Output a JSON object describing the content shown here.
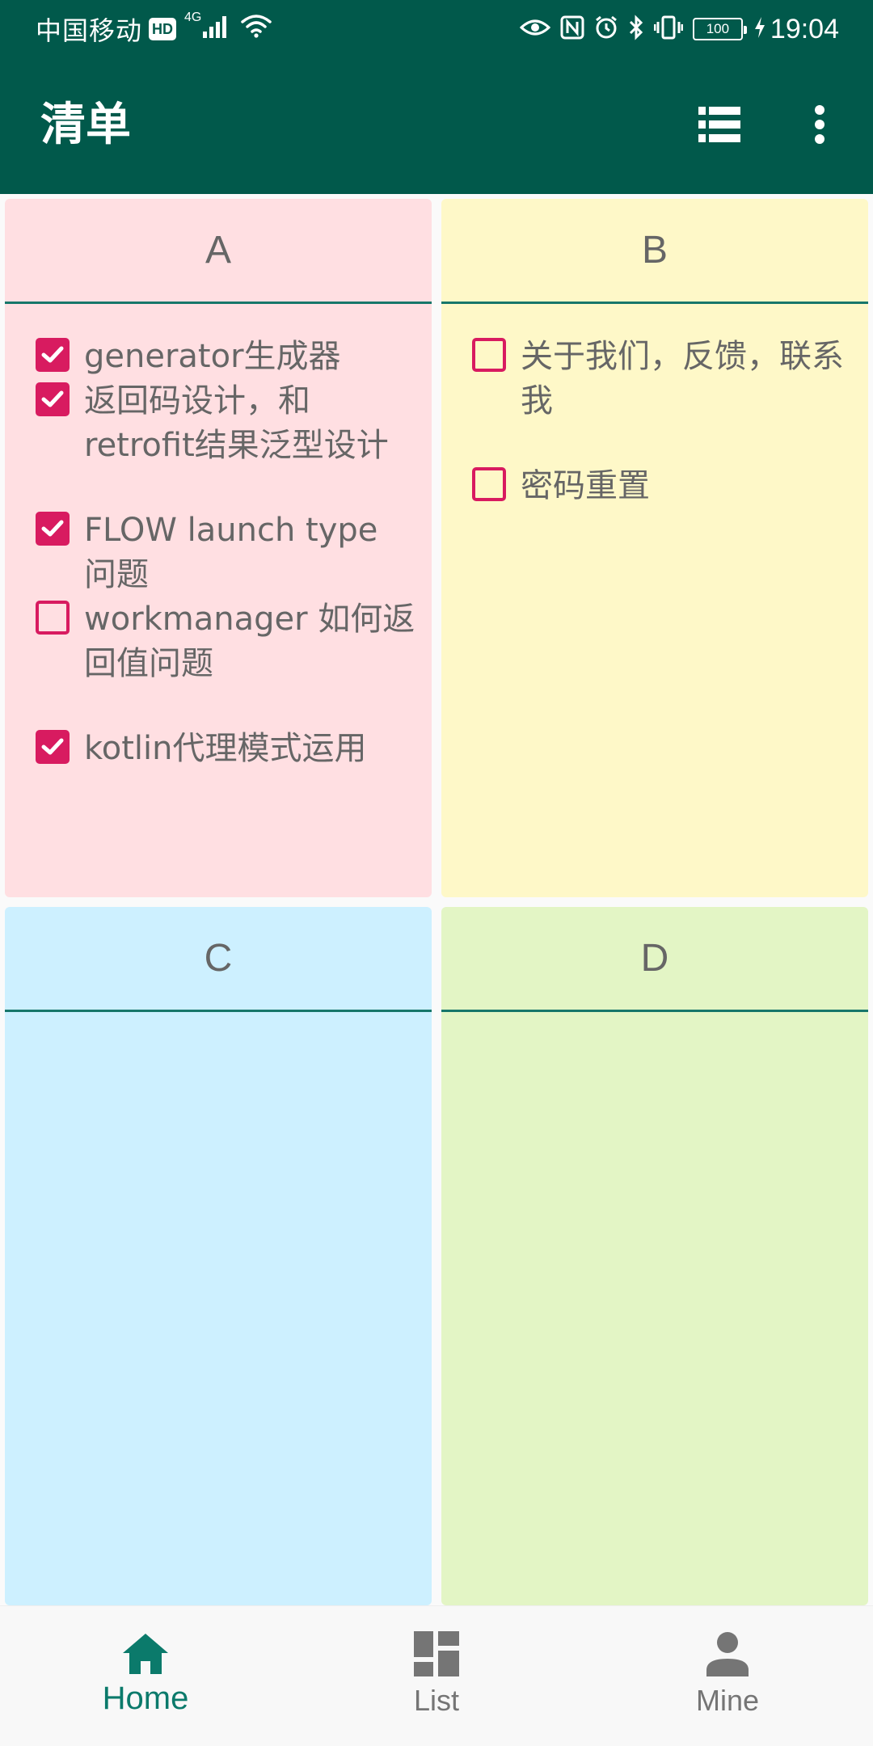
{
  "status_bar": {
    "carrier": "中国移动",
    "hd_badge": "HD",
    "network": "4G",
    "battery": "100",
    "time": "19:04"
  },
  "app_bar": {
    "title": "清单",
    "icons": [
      "list-view-icon",
      "more-vert-icon"
    ]
  },
  "quadrants": {
    "a": {
      "title": "A",
      "color": "#ffdfe2",
      "tasks": [
        {
          "text": "generator生成器",
          "done": true
        },
        {
          "text": "返回码设计，和retrofit结果泛型设计",
          "done": true
        },
        {
          "text": "FLOW launch type 问题",
          "done": true
        },
        {
          "text": "workmanager 如何返回值问题",
          "done": false
        },
        {
          "text": "kotlin代理模式运用",
          "done": true
        }
      ]
    },
    "b": {
      "title": "B",
      "color": "#fef8c8",
      "tasks": [
        {
          "text": "关于我们，反馈，联系我",
          "done": false
        },
        {
          "text": "密码重置",
          "done": false
        }
      ]
    },
    "c": {
      "title": "C",
      "color": "#cdf0ff",
      "tasks": []
    },
    "d": {
      "title": "D",
      "color": "#e3f5c5",
      "tasks": []
    }
  },
  "accent_color": "#d81b60",
  "primary_color": "#01594b",
  "bottom_nav": {
    "items": [
      {
        "label": "Home",
        "icon": "home-icon",
        "active": true
      },
      {
        "label": "List",
        "icon": "dashboard-icon",
        "active": false
      },
      {
        "label": "Mine",
        "icon": "person-icon",
        "active": false
      }
    ]
  }
}
